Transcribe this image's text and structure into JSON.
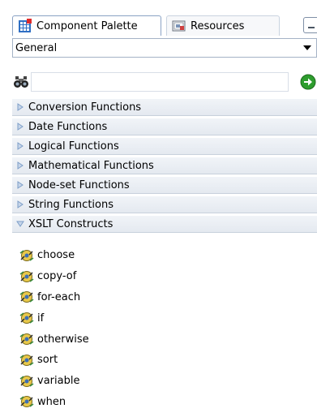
{
  "tabs": [
    {
      "label": "Component Palette",
      "icon": "palette-icon",
      "active": true
    },
    {
      "label": "Resources",
      "icon": "resources-icon",
      "active": false
    }
  ],
  "dropdown": {
    "selected": "General"
  },
  "search": {
    "value": "",
    "placeholder": ""
  },
  "categories": [
    {
      "label": "Conversion Functions",
      "expanded": false
    },
    {
      "label": "Date Functions",
      "expanded": false
    },
    {
      "label": "Logical Functions",
      "expanded": false
    },
    {
      "label": "Mathematical Functions",
      "expanded": false
    },
    {
      "label": "Node-set Functions",
      "expanded": false
    },
    {
      "label": "String Functions",
      "expanded": false
    },
    {
      "label": "XSLT Constructs",
      "expanded": true
    }
  ],
  "items": [
    {
      "label": "choose"
    },
    {
      "label": "copy-of"
    },
    {
      "label": "for-each"
    },
    {
      "label": "if"
    },
    {
      "label": "otherwise"
    },
    {
      "label": "sort"
    },
    {
      "label": "variable"
    },
    {
      "label": "when"
    }
  ],
  "colors": {
    "tab_border": "#8aa2c4",
    "category_bg": "#e4e9f0",
    "go_button": "#2e9d2e"
  }
}
